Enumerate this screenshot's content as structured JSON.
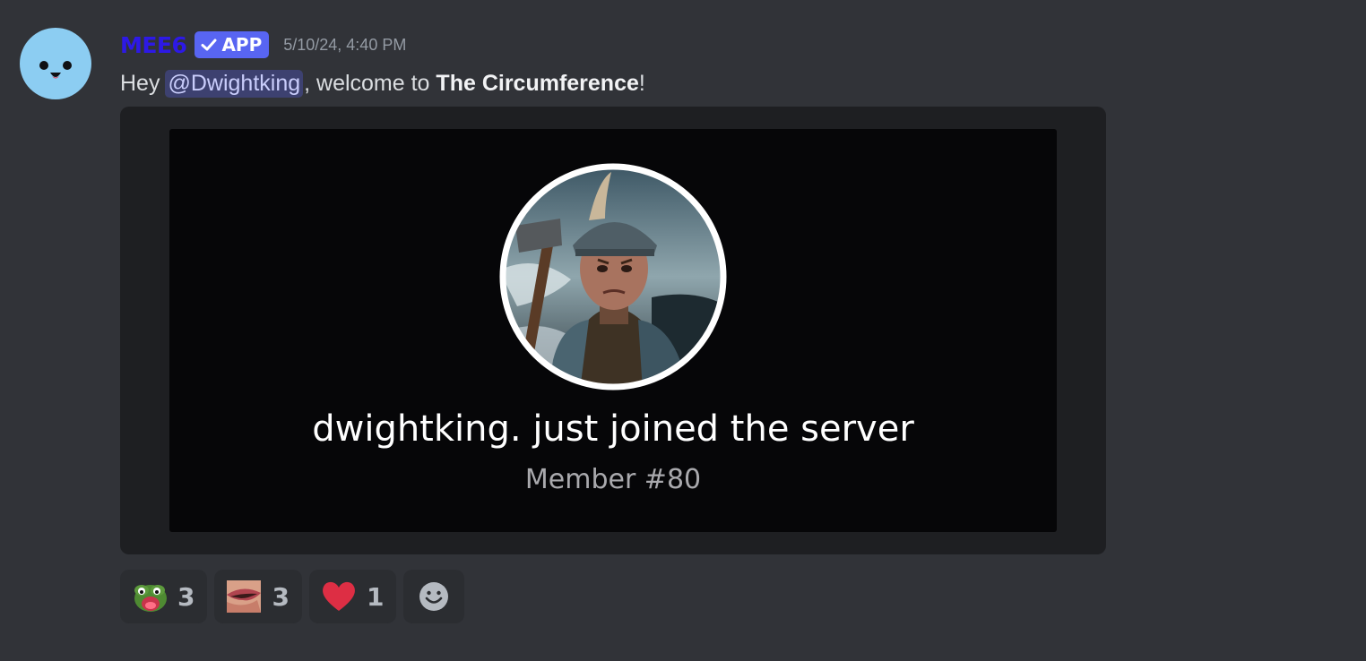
{
  "message": {
    "author": "MEE6",
    "badge": "APP",
    "timestamp": "5/10/24, 4:40 PM",
    "greeting": "Hey",
    "mention": "@Dwightking",
    "welcome_text": ", welcome to",
    "server_name": "The Circumference",
    "end_punct": "!"
  },
  "embed": {
    "join_text": "dwightking. just joined the server",
    "member_count": "Member #80"
  },
  "reactions": [
    {
      "emoji": "pepe-icon",
      "count": "3"
    },
    {
      "emoji": "lips-icon",
      "count": "3"
    },
    {
      "emoji": "red-heart-icon",
      "count": "1"
    }
  ],
  "colors": {
    "background": "#313338",
    "username": "#2d19e6",
    "badge": "#5865f2",
    "mention_bg": "#3c4270",
    "embed_bg": "#1e1f22",
    "avatar_bg": "#8ccdf2"
  }
}
